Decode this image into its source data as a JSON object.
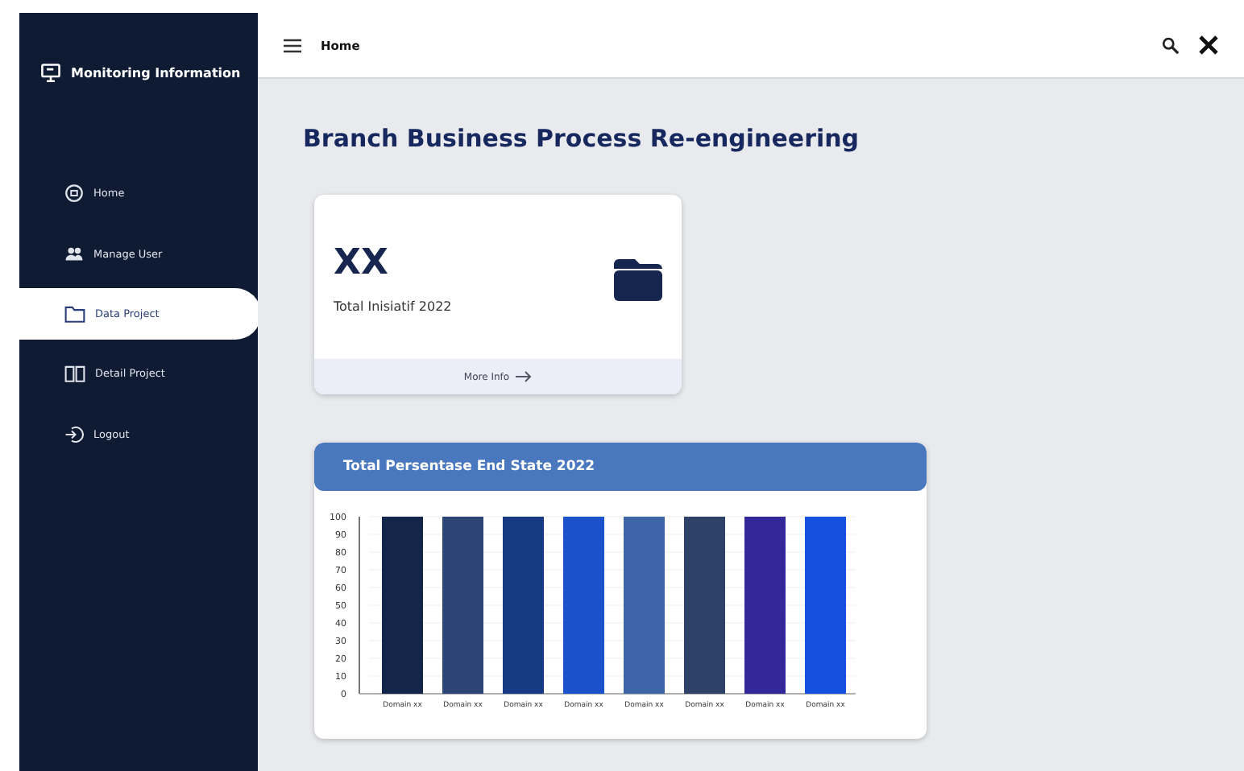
{
  "sidebar": {
    "title": "Monitoring Information",
    "items": [
      {
        "label": "Home",
        "selected": false
      },
      {
        "label": "Manage User",
        "selected": false
      },
      {
        "label": "Data Project",
        "selected": true
      },
      {
        "label": "Detail Project",
        "selected": false
      },
      {
        "label": "Logout",
        "selected": false
      }
    ]
  },
  "topbar": {
    "title": "Home"
  },
  "page": {
    "heading": "Branch Business Process Re-engineering"
  },
  "stat_card": {
    "value": "XX",
    "label": "Total Inisiatif 2022",
    "link": "More Info"
  },
  "chart_card": {
    "title": "Total Persentase End State 2022",
    "chart_data": {
      "type": "bar",
      "categories": [
        "Domain xx",
        "Domain xx",
        "Domain xx",
        "Domain xx",
        "Domain xx",
        "Domain xx",
        "Domain xx",
        "Domain xx"
      ],
      "values": [
        100,
        100,
        100,
        100,
        100,
        100,
        100,
        100
      ],
      "grid": true,
      "colors": [
        "#14254a",
        "#2d4576",
        "#173a85",
        "#1b52cc",
        "#3d65a8",
        "#2e4268",
        "#33289a",
        "#1550e0"
      ],
      "ylim": [
        0,
        100
      ],
      "yticks": [
        0,
        10,
        20,
        30,
        40,
        50,
        60,
        70,
        80,
        90,
        100
      ]
    }
  }
}
